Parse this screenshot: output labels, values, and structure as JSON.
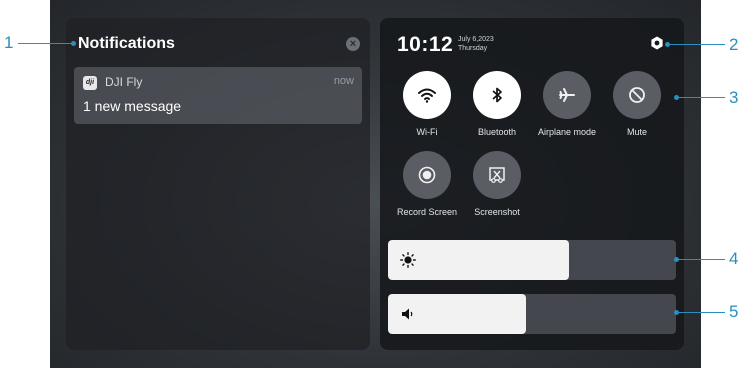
{
  "notifications": {
    "title": "Notifications",
    "clear_icon": "close-icon",
    "items": [
      {
        "app_icon": "dji-app-icon",
        "app_icon_text": "dji",
        "app": "DJI Fly",
        "time": "now",
        "message": "1 new message"
      }
    ]
  },
  "control_center": {
    "clock": "10:12",
    "date": "July 6,2023",
    "weekday": "Thursday",
    "settings_icon": "settings-hexagon-icon",
    "tiles": [
      {
        "label": "Wi-Fi",
        "icon": "wifi-icon",
        "active": true
      },
      {
        "label": "Bluetooth",
        "icon": "bluetooth-icon",
        "active": true
      },
      {
        "label": "Airplane mode",
        "icon": "airplane-icon",
        "active": false
      },
      {
        "label": "Mute",
        "icon": "mute-icon",
        "active": false
      },
      {
        "label": "Record Screen",
        "icon": "record-icon",
        "active": false
      },
      {
        "label": "Screenshot",
        "icon": "screenshot-icon",
        "active": false
      }
    ],
    "brightness": {
      "icon": "brightness-icon",
      "level": 0.63
    },
    "volume": {
      "icon": "volume-icon",
      "level": 0.48
    }
  },
  "callouts": [
    "1",
    "2",
    "3",
    "4",
    "5"
  ],
  "colors": {
    "callout": "#2a8fbf",
    "tile_on": "#ffffff",
    "tile_off": "#5a5e64"
  }
}
